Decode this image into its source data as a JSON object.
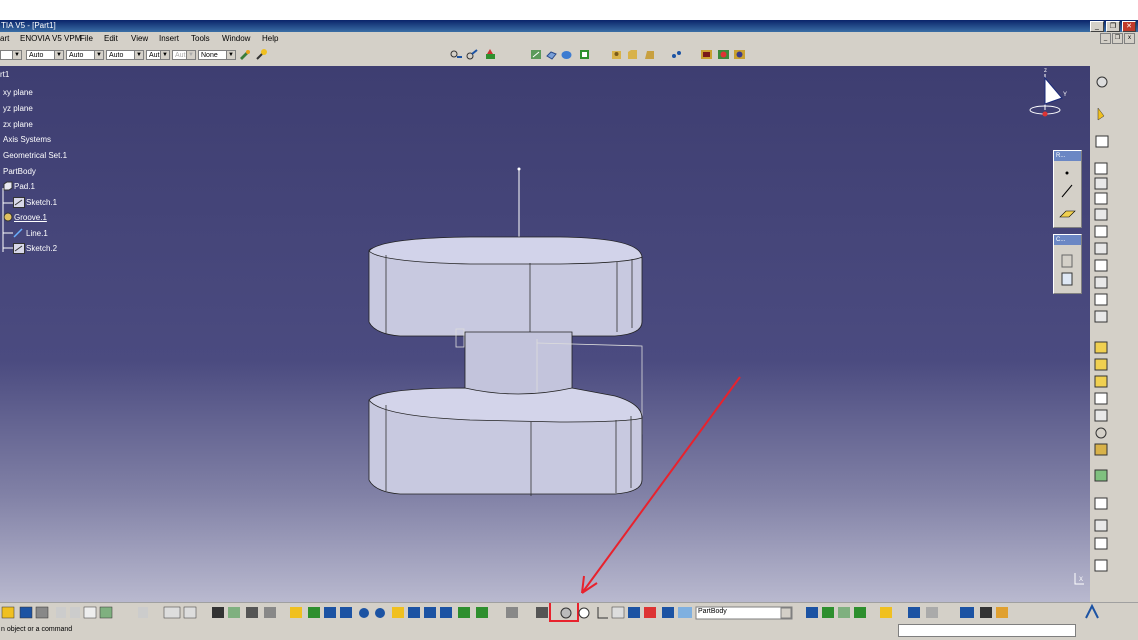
{
  "window": {
    "title": "TIA V5 - [Part1]"
  },
  "menu": {
    "items": [
      "art",
      "ENOVIA V5 VPM",
      "File",
      "Edit",
      "View",
      "Insert",
      "Tools",
      "Window",
      "Help"
    ]
  },
  "properties_toolbar": {
    "dropdowns": [
      "",
      "Auto",
      "Auto",
      "Auto",
      "Aut",
      "Aut",
      "None"
    ]
  },
  "tree": {
    "items": [
      "rt1",
      "xy plane",
      "yz plane",
      "zx plane",
      "Axis Systems",
      "Geometrical Set.1",
      "PartBody",
      "Pad.1",
      "Sketch.1",
      "Groove.1",
      "Line.1",
      "Sketch.2"
    ]
  },
  "compass": {
    "axis_y": "Y",
    "axis_x": "X",
    "axis_z": "z"
  },
  "palettes": {
    "palette1_title": "R...",
    "palette2_title": "C..."
  },
  "bottom_toolbar": {
    "current_body": "PartBody"
  },
  "status": {
    "message": "n object or a command"
  },
  "colors": {
    "viewport_top": "#3e3e71",
    "viewport_bottom": "#b9b9cf",
    "annotation_red": "#e8222d",
    "part_face": "#cfd0e6"
  }
}
